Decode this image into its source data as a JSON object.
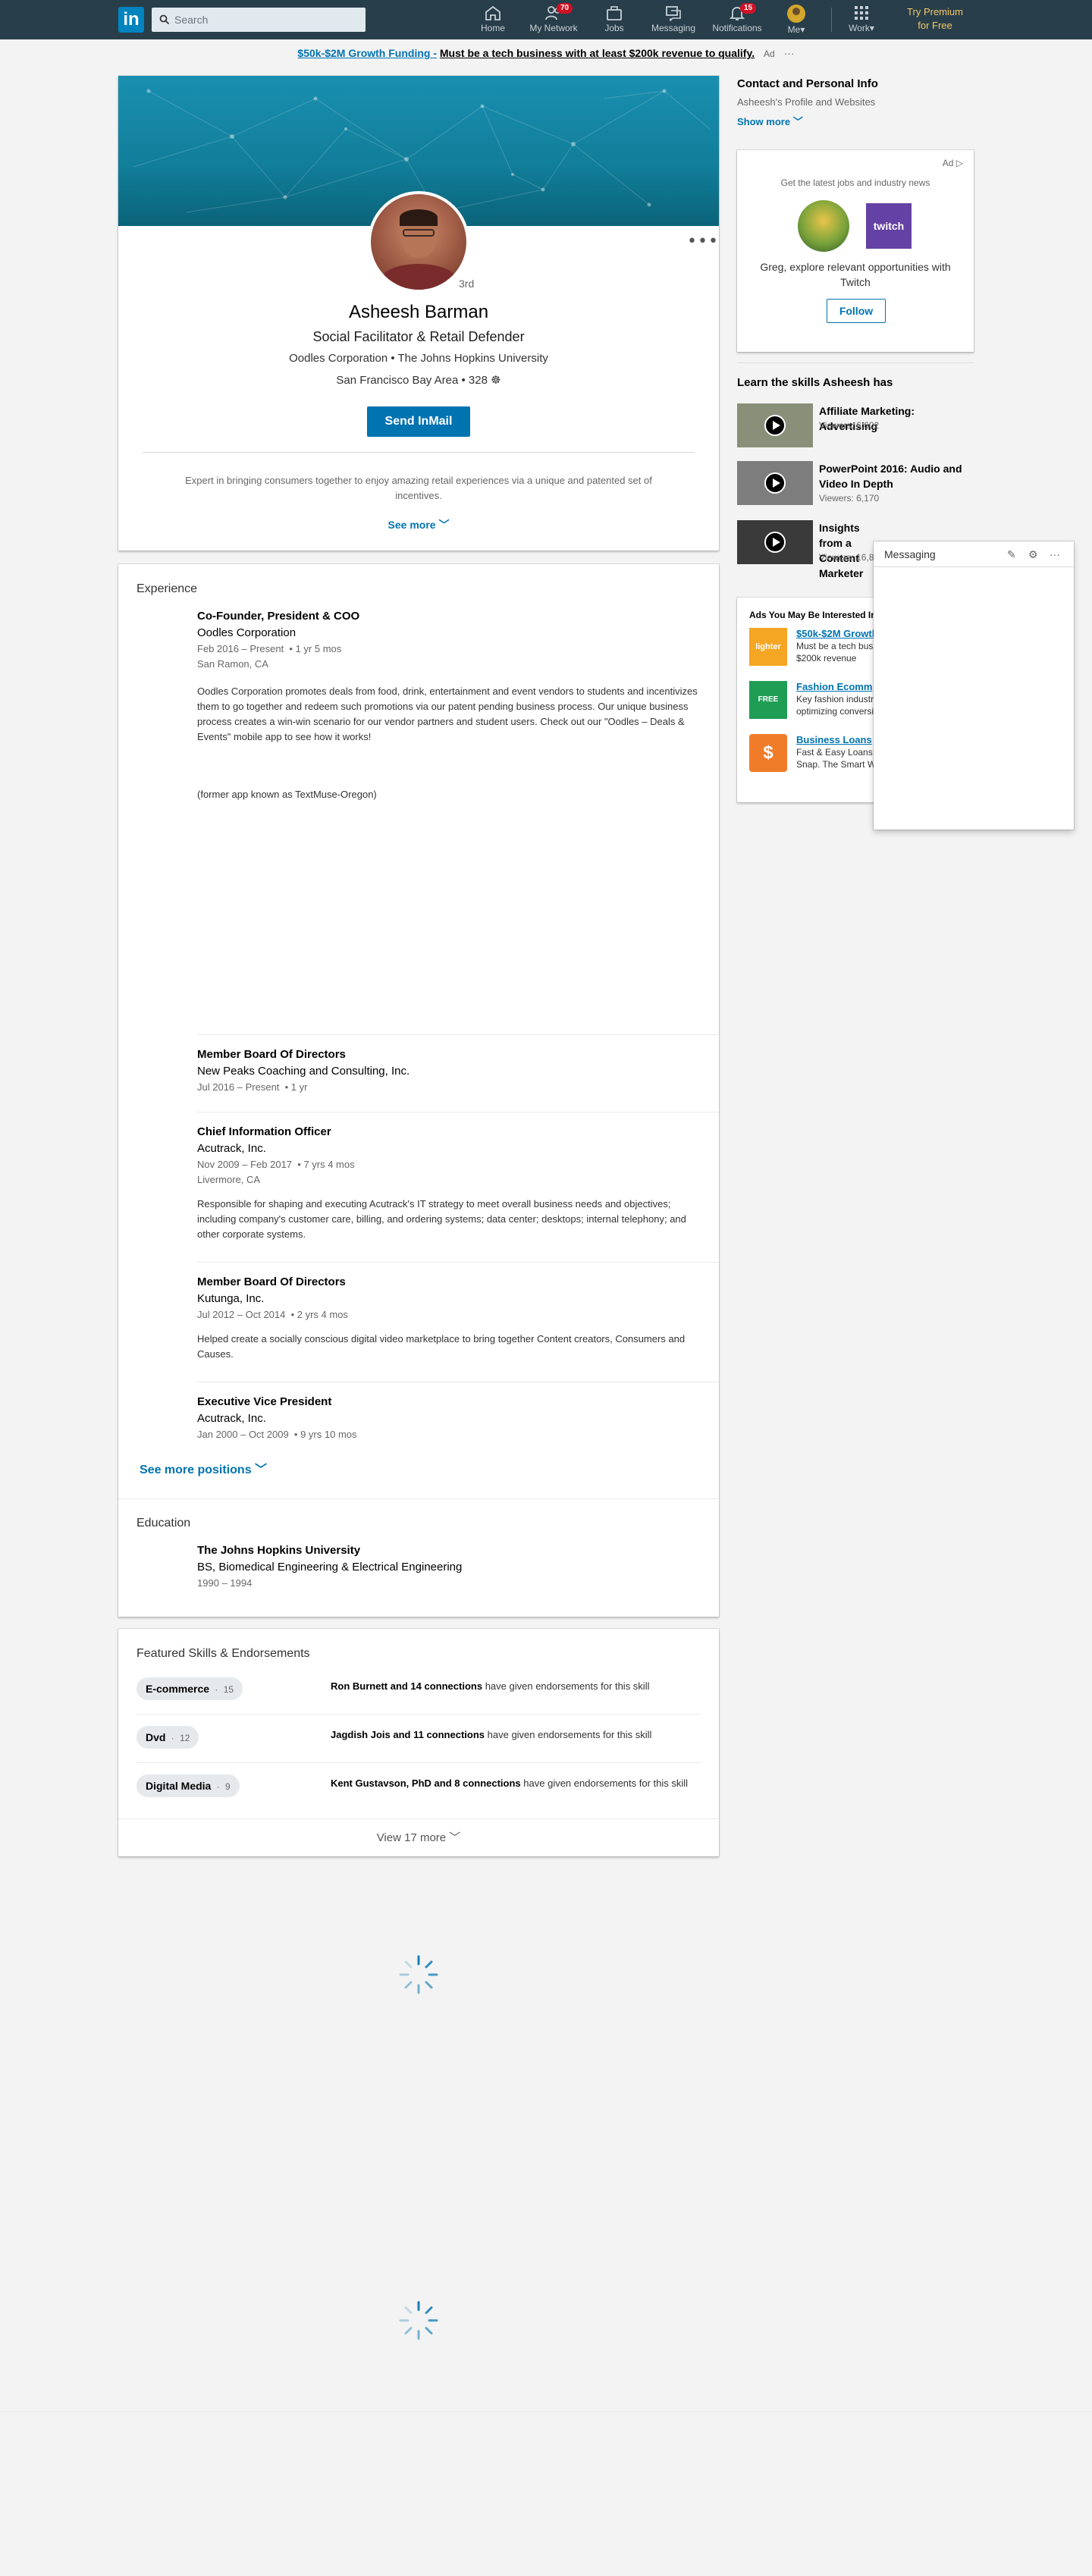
{
  "nav": {
    "logo": "in",
    "search_placeholder": "Search",
    "items": [
      {
        "label": "Home"
      },
      {
        "label": "My Network",
        "badge": "70"
      },
      {
        "label": "Jobs"
      },
      {
        "label": "Messaging"
      },
      {
        "label": "Notifications",
        "badge": "15"
      },
      {
        "label": "Me"
      },
      {
        "label": "Work"
      }
    ],
    "premium": [
      "Try Premium",
      "for Free"
    ]
  },
  "ad_banner": {
    "link": "$50k-$2M Growth Funding -",
    "text": "Must be a tech business with at least $200k revenue to qualify.",
    "tag": "Ad",
    "more": "···"
  },
  "profile": {
    "name": "Asheesh Barman",
    "degree": "3rd",
    "headline": "Social Facilitator & Retail Defender",
    "company_school": "Oodles Corporation • The Johns Hopkins University",
    "location_connections": "San Francisco Bay Area • 328 ☸",
    "inmail_button": "Send InMail",
    "summary": "Expert in bringing consumers together to enjoy amazing retail experiences via a unique and patented set of incentives.",
    "see_more": "See more"
  },
  "experience": {
    "title": "Experience",
    "positions": [
      {
        "title": "Co-Founder, President & COO",
        "company": "Oodles Corporation",
        "dates": "Feb 2016 – Present",
        "duration": "1 yr 5 mos",
        "location": "San Ramon, CA",
        "description": "Oodles Corporation promotes deals from food, drink, entertainment and event vendors to students and incentivizes them to go together and redeem such promotions via our patent pending business process. Our unique business process creates a win-win scenario for our vendor partners and student users. Check out our \"Oodles – Deals & Events\" mobile app to see how it works!",
        "note": "(former app known as TextMuse-Oregon)"
      },
      {
        "title": "Member Board Of Directors",
        "company": "New Peaks Coaching and Consulting, Inc.",
        "dates": "Jul 2016 – Present",
        "duration": "1 yr"
      },
      {
        "title": "Chief Information Officer",
        "company": "Acutrack, Inc.",
        "dates": "Nov 2009 – Feb 2017",
        "duration": "7 yrs 4 mos",
        "location": "Livermore, CA",
        "description": "Responsible for shaping and executing Acutrack's IT strategy to meet overall business needs and objectives; including company's customer care, billing, and ordering systems; data center; desktops; internal telephony; and other corporate systems."
      },
      {
        "title": "Member Board Of Directors",
        "company": "Kutunga, Inc.",
        "dates": "Jul 2012 – Oct 2014",
        "duration": "2 yrs 4 mos",
        "description": "Helped create a socially conscious digital video marketplace to bring together Content creators, Consumers and Causes."
      },
      {
        "title": "Executive Vice President",
        "company": "Acutrack, Inc.",
        "dates": "Jan 2000 – Oct 2009",
        "duration": "9 yrs 10 mos"
      }
    ],
    "see_more": "See more positions"
  },
  "education": {
    "title": "Education",
    "school": "The Johns Hopkins University",
    "degree": "BS, Biomedical Engineering & Electrical Engineering",
    "dates": "1990 – 1994"
  },
  "skills": {
    "title": "Featured Skills & Endorsements",
    "items": [
      {
        "name": "E-commerce",
        "count": "15",
        "endorser": "Ron Burnett and 14 connections",
        "text": "have given endorsements for this skill"
      },
      {
        "name": "Dvd",
        "count": "12",
        "endorser": "Jagdish Jois and 11 connections",
        "text": "have given endorsements for this skill"
      },
      {
        "name": "Digital Media",
        "count": "9",
        "endorser": "Kent Gustavson, PhD and 8 connections",
        "text": "have given endorsements for this skill"
      }
    ],
    "view_more": "View 17 more"
  },
  "right_rail": {
    "contact_title": "Contact and Personal Info",
    "contact_sub": "Asheesh's Profile and Websites",
    "show_more": "Show more",
    "ad_card": {
      "tag": "Ad",
      "heading": "Get the latest jobs and industry news",
      "brand": "twitch",
      "message": "Greg, explore relevant opportunities with Twitch",
      "follow": "Follow"
    },
    "learn_title": "Learn the skills Asheesh has",
    "courses": [
      {
        "title": "Affiliate Marketing: Advertising",
        "viewers": "Viewers: 6,602"
      },
      {
        "title": "PowerPoint 2016: Audio and Video In Depth",
        "viewers": "Viewers: 6,170"
      },
      {
        "title": "Insights from a Content Marketer",
        "viewers": "Viewers: 16,8"
      }
    ],
    "ads_heading": "Ads You May Be Interested In",
    "ads": [
      {
        "title": "$50k-$2M Growth",
        "text": "Must be a tech business with at least $200k revenue",
        "icon_text": "lighter capital"
      },
      {
        "title": "Fashion Ecomm",
        "text": "Key fashion industry tips on optimizing conversions and sales.",
        "icon_text": "FREE EBOOK"
      },
      {
        "title": "Business Loans",
        "text": "Fast & Easy Loans. Fast Approvals. Snap. The Smart Way To Borrow.",
        "icon_text": "$"
      }
    ]
  },
  "messaging": {
    "title": "Messaging"
  }
}
